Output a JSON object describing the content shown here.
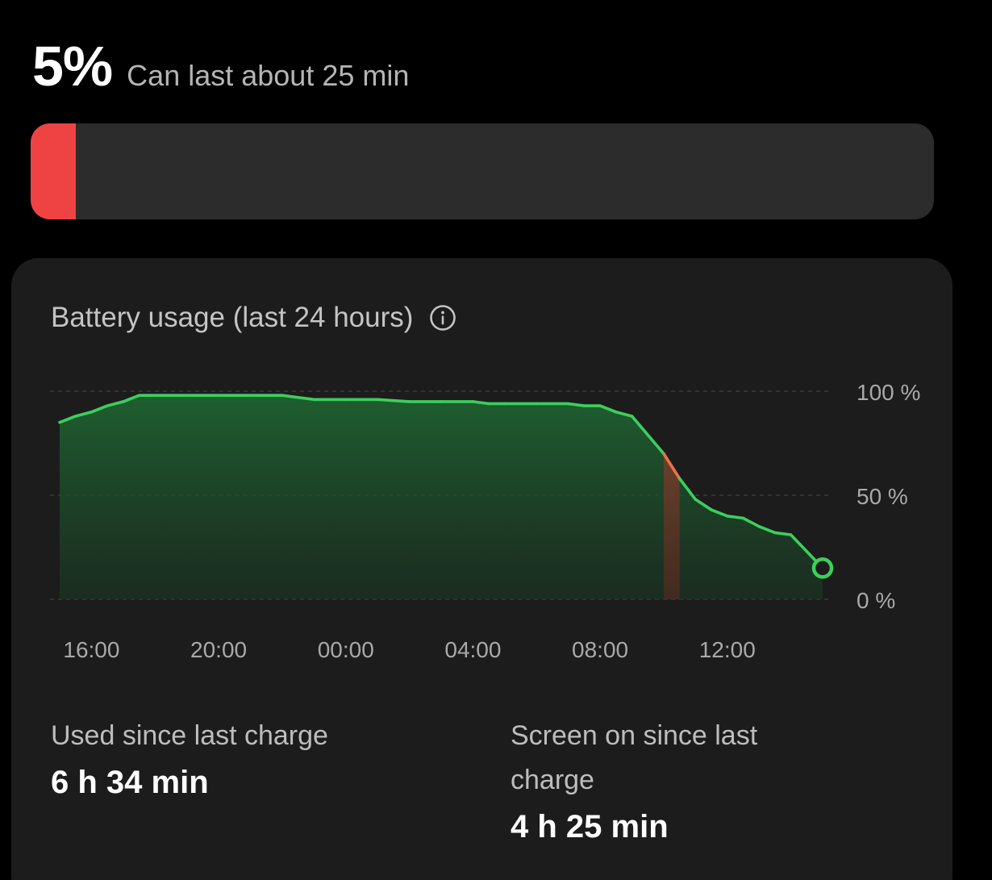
{
  "battery": {
    "percent_label": "5%",
    "level_percent": 5,
    "estimate": "Can last about 25 min",
    "level_color": "#ef4343"
  },
  "usage_card": {
    "title": "Battery usage (last 24 hours)",
    "info_icon": "info-circle-icon"
  },
  "chart_data": {
    "type": "area",
    "title": "Battery usage (last 24 hours)",
    "x_tick_labels": [
      "16:00",
      "20:00",
      "00:00",
      "04:00",
      "08:00",
      "12:00"
    ],
    "y_tick_labels": [
      "100 %",
      "50 %",
      "0 %"
    ],
    "ylim": [
      0,
      100
    ],
    "xlim_hours": [
      15,
      39
    ],
    "grid": true,
    "line_color": "#3ccf5c",
    "highlight_color": "#e8734a",
    "series": [
      {
        "x_hours": [
          15.0,
          15.5,
          16.0,
          16.5,
          17.0,
          17.5,
          18.0,
          19.0,
          20.0,
          21.0,
          22.0,
          22.5,
          23.0,
          24.0,
          24.5,
          25.0,
          26.0,
          27.0,
          28.0,
          28.5,
          29.0,
          30.0,
          31.0,
          31.5,
          32.0,
          32.5,
          33.0,
          34.0,
          34.5,
          35.0,
          35.5,
          36.0,
          36.5,
          37.0,
          37.5,
          38.0,
          38.5,
          39.0
        ],
        "y_percent": [
          85,
          88,
          90,
          93,
          95,
          98,
          98,
          98,
          98,
          98,
          98,
          97,
          96,
          96,
          96,
          96,
          95,
          95,
          95,
          94,
          94,
          94,
          94,
          93,
          93,
          90,
          88,
          70,
          58,
          48,
          43,
          40,
          39,
          35,
          32,
          31,
          23,
          15
        ]
      }
    ],
    "highlight_range_hours": [
      34.0,
      34.5
    ]
  },
  "stats": {
    "used": {
      "label": "Used since last charge",
      "value": "6 h 34 min"
    },
    "screen_on": {
      "label_line1": "Screen on since last",
      "label_line2": "charge",
      "value": "4 h 25 min"
    }
  }
}
